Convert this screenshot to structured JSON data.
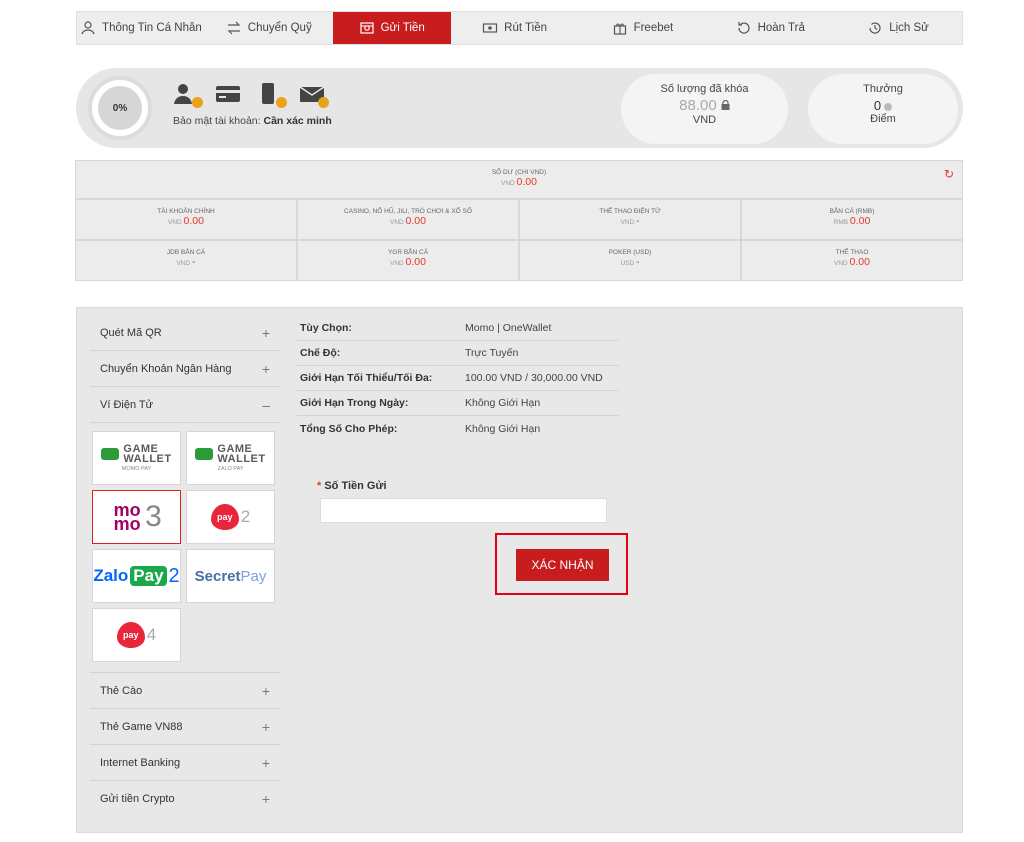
{
  "nav": {
    "tabs": [
      {
        "label": "Thông Tin Cá Nhân",
        "icon": "user-icon"
      },
      {
        "label": "Chuyển Quỹ",
        "icon": "transfer-icon"
      },
      {
        "label": "Gửi Tiền",
        "icon": "deposit-icon",
        "active": true
      },
      {
        "label": "Rút Tiền",
        "icon": "withdraw-icon"
      },
      {
        "label": "Freebet",
        "icon": "gift-icon"
      },
      {
        "label": "Hoàn Trả",
        "icon": "refund-icon"
      },
      {
        "label": "Lịch Sử",
        "icon": "history-icon"
      }
    ]
  },
  "security": {
    "percent": "0%",
    "label": "Bảo mật tài khoản:",
    "status": "Cần xác minh"
  },
  "locked": {
    "title": "Số lượng đã khóa",
    "amount": "88.00",
    "currency": "VND"
  },
  "reward": {
    "title": "Thưởng",
    "amount": "0",
    "unit": "Điểm"
  },
  "balance": {
    "total": {
      "label": "SỐ DƯ (CHI VND)",
      "unit": "VND",
      "value": "0.00"
    },
    "row1": [
      {
        "label": "TÀI KHOẢN CHÍNH",
        "unit": "VND",
        "value": "0.00"
      },
      {
        "label": "CASINO, NỔ HŨ, JILI, TRÒ CHƠI & XỔ SỐ",
        "unit": "VND",
        "value": "0.00"
      },
      {
        "label": "THỂ THAO ĐIỆN TỬ",
        "unit": "VND",
        "value": "-"
      },
      {
        "label": "BẮN CÁ (RMB)",
        "unit": "RMB",
        "value": "0.00"
      }
    ],
    "row2": [
      {
        "label": "JDB BẮN CÁ",
        "unit": "VND",
        "value": "-"
      },
      {
        "label": "YGR BẮN CÁ",
        "unit": "VND",
        "value": "0.00"
      },
      {
        "label": "POKER (USD)",
        "unit": "USD",
        "value": "-"
      },
      {
        "label": "THỂ THAO",
        "unit": "VND",
        "value": "0.00"
      }
    ]
  },
  "sidebar": {
    "top": [
      {
        "label": "Quét Mã QR",
        "toggle": "+"
      },
      {
        "label": "Chuyển Khoản Ngân Hàng",
        "toggle": "+"
      },
      {
        "label": "Ví Điện Tử",
        "toggle": "–"
      }
    ],
    "wallets": {
      "game_word1": "GAME",
      "game_word2": "WALLET",
      "momo_sub": "MOMO PAY",
      "zalo_sub": "ZALO PAY",
      "momo_logo": "mo mo",
      "momo_num": "3",
      "viettel2": "2",
      "viettel4": "4",
      "pay_text": "pay",
      "zalo_text": "Zalo",
      "zalo_pay": "Pay",
      "zalo_num": "2",
      "secret_a": "Secret",
      "secret_b": "Pay"
    },
    "bottom": [
      {
        "label": "Thẻ Cào",
        "toggle": "+"
      },
      {
        "label": "Thẻ Game VN88",
        "toggle": "+"
      },
      {
        "label": "Internet Banking",
        "toggle": "+"
      },
      {
        "label": "Gửi tiền Crypto",
        "toggle": "+"
      }
    ]
  },
  "details": [
    {
      "key": "Tùy Chọn:",
      "value": "Momo | OneWallet"
    },
    {
      "key": "Chế Độ:",
      "value": "Trực Tuyến"
    },
    {
      "key": "Giới Hạn Tối Thiểu/Tối Đa:",
      "value": "100.00 VND / 30,000.00 VND"
    },
    {
      "key": "Giới Hạn Trong Ngày:",
      "value": "Không Giới Hạn"
    },
    {
      "key": "Tổng Số Cho Phép:",
      "value": "Không Giới Hạn"
    }
  ],
  "form": {
    "required_mark": "*",
    "amount_label": "Số Tiền Gửi",
    "amount_value": "",
    "submit_label": "XÁC NHẬN"
  },
  "colors": {
    "brand_red": "#c81d1f",
    "value_red": "#e53a2a",
    "momo": "#a50064"
  }
}
